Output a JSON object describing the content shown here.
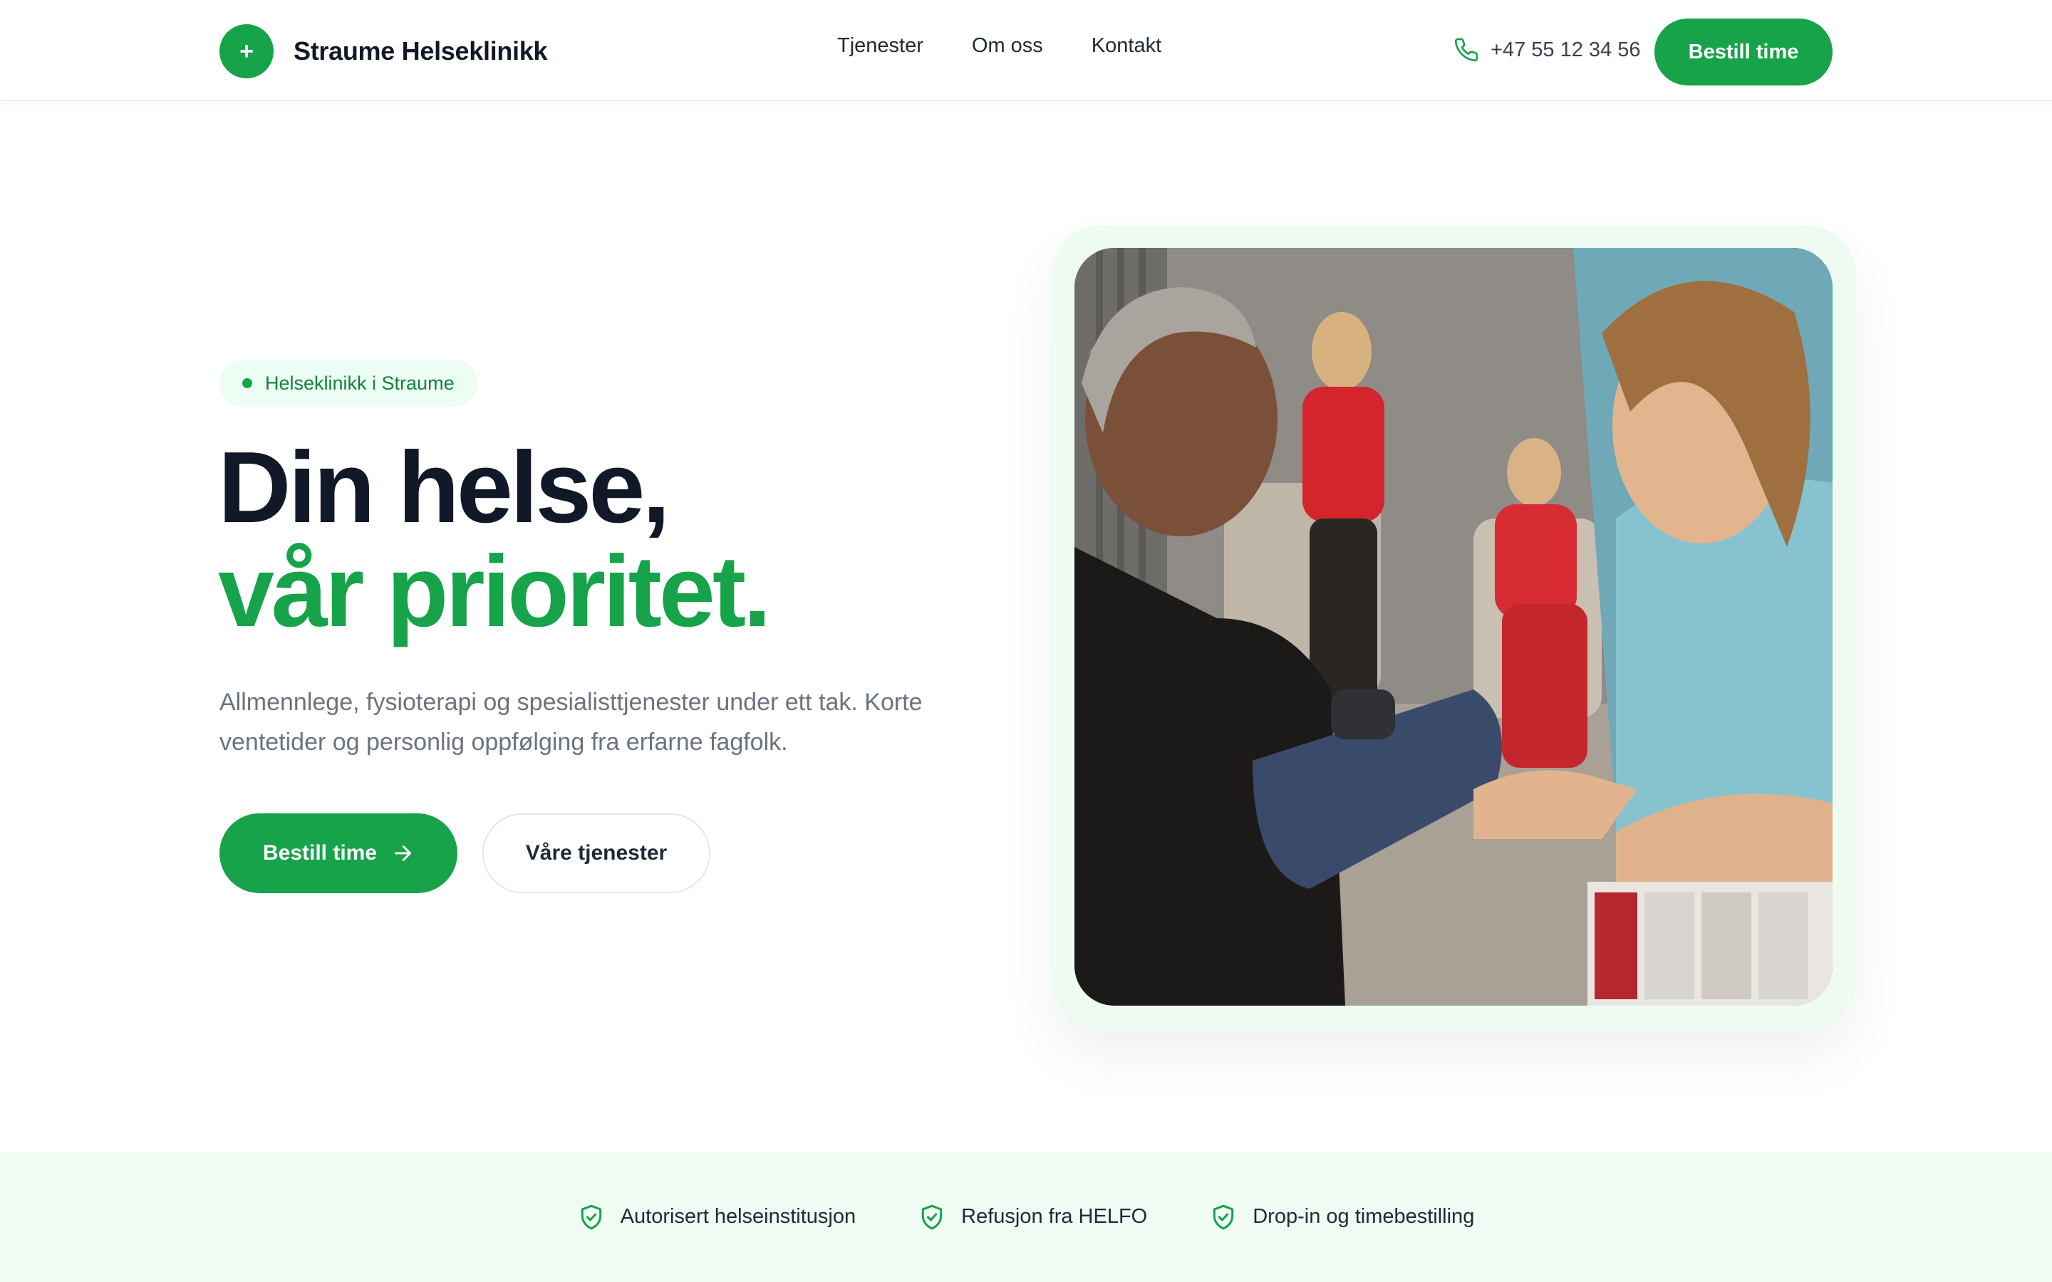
{
  "header": {
    "logo_glyph": "+",
    "brand_name": "Straume Helseklinikk",
    "nav": [
      "Tjenester",
      "Om oss",
      "Kontakt"
    ],
    "phone": "+47 55 12 34 56",
    "cta_label": "Bestill time"
  },
  "hero": {
    "badge": "Helseklinikk i Straume",
    "title_line1": "Din helse,",
    "title_line2": "vår prioritet.",
    "description": "Allmennlege, fysioterapi og spesialisttjenester under ett tak. Korte ventetider og personlig oppfølging fra erfarne fagfolk.",
    "primary_button": "Bestill time",
    "secondary_button": "Våre tjenester"
  },
  "trust_bar": {
    "items": [
      "Autorisert helseinstitusjon",
      "Refusjon fra HELFO",
      "Drop-in og timebestilling"
    ]
  },
  "colors": {
    "accent": "#16a34a",
    "accent_light": "#ecfdf3",
    "text_dark": "#111827",
    "text_muted": "#6b7280"
  },
  "icons": {
    "phone": "phone-icon",
    "arrow": "arrow-right-icon",
    "shield": "shield-check-icon"
  }
}
